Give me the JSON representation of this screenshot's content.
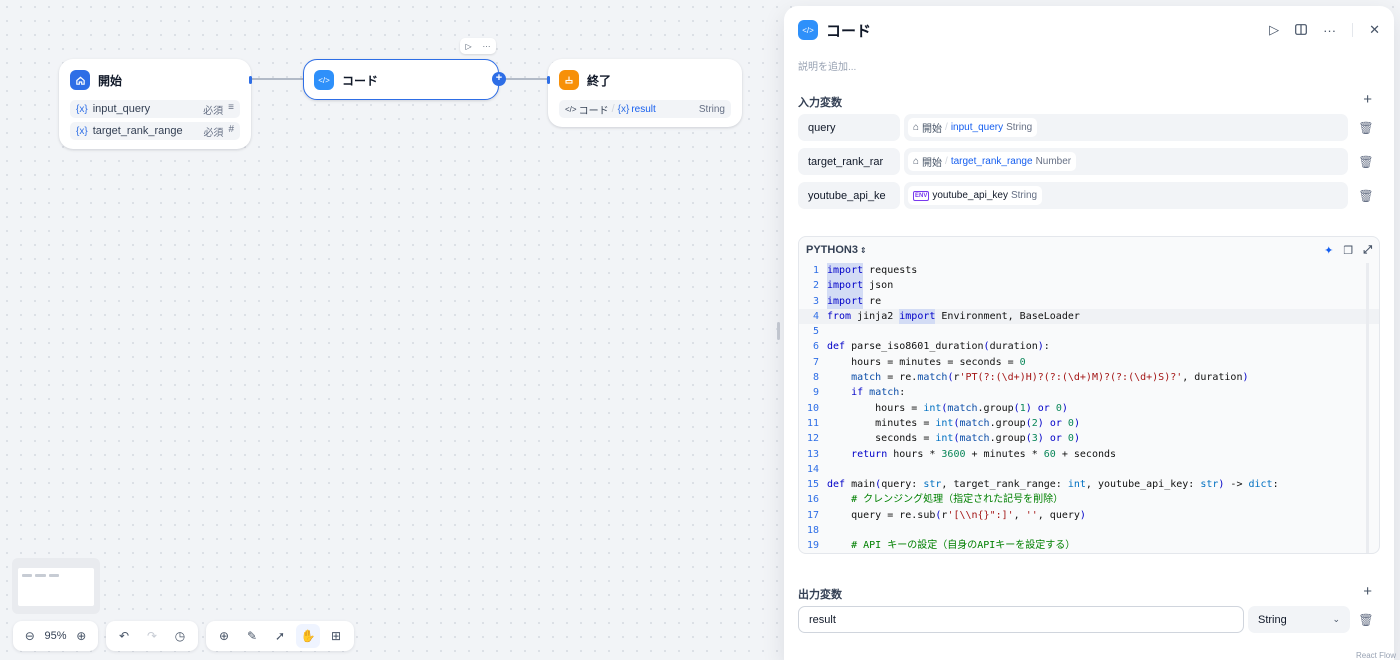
{
  "nodes": {
    "start": {
      "title": "開始",
      "vars": [
        {
          "name": "input_query",
          "required": "必須",
          "type_icon": "text-lines-icon"
        },
        {
          "name": "target_rank_range",
          "required": "必須",
          "type_icon": "hash-icon"
        }
      ]
    },
    "code": {
      "title": "コード"
    },
    "end": {
      "title": "終了",
      "source_node": "コード",
      "var_name": "result",
      "var_type": "String"
    }
  },
  "panel": {
    "title": "コード",
    "description_placeholder": "説明を追加...",
    "input_section_title": "入力変数",
    "inputs": [
      {
        "name": "query",
        "source_node": "開始",
        "var_name": "input_query",
        "var_type": "String"
      },
      {
        "name": "target_rank_rar",
        "source_node": "開始",
        "var_name": "target_rank_range",
        "var_type": "Number"
      },
      {
        "name": "youtube_api_ke",
        "source_node": "",
        "var_name": "youtube_api_key",
        "var_type": "String"
      }
    ],
    "language": "PYTHON3",
    "output_section_title": "出力変数",
    "output": {
      "name": "result",
      "type": "String"
    }
  },
  "code_lines": [
    {
      "n": "1",
      "active": false,
      "tokens": [
        [
          "kwsel",
          "import"
        ],
        [
          "ct",
          " requests"
        ]
      ]
    },
    {
      "n": "2",
      "active": false,
      "tokens": [
        [
          "kwsel",
          "import"
        ],
        [
          "ct",
          " json"
        ]
      ]
    },
    {
      "n": "3",
      "active": false,
      "tokens": [
        [
          "kwsel",
          "import"
        ],
        [
          "ct",
          " re"
        ]
      ]
    },
    {
      "n": "4",
      "active": true,
      "tokens": [
        [
          "kw",
          "from"
        ],
        [
          "ct",
          " jinja2 "
        ],
        [
          "kwsel",
          "import"
        ],
        [
          "ct",
          " Environment, BaseLoader"
        ]
      ]
    },
    {
      "n": "5",
      "active": false,
      "tokens": []
    },
    {
      "n": "6",
      "active": false,
      "tokens": [
        [
          "kw",
          "def"
        ],
        [
          "ct",
          " parse_iso8601_duration"
        ],
        [
          "kw",
          "("
        ],
        [
          "ct",
          "duration"
        ],
        [
          "kw",
          ")"
        ],
        [
          "ct",
          ":"
        ]
      ]
    },
    {
      "n": "7",
      "active": false,
      "tokens": [
        [
          "ct",
          "    hours = minutes = seconds = "
        ],
        [
          "num",
          "0"
        ]
      ]
    },
    {
      "n": "8",
      "active": false,
      "tokens": [
        [
          "ct",
          "    "
        ],
        [
          "vr",
          "match"
        ],
        [
          "ct",
          " = re."
        ],
        [
          "vr",
          "match"
        ],
        [
          "kw",
          "("
        ],
        [
          "ct",
          "r"
        ],
        [
          "str",
          "'PT(?:(\\d+)H)?(?:(\\d+)M)?(?:(\\d+)S)?'"
        ],
        [
          "ct",
          ", duration"
        ],
        [
          "kw",
          ")"
        ]
      ]
    },
    {
      "n": "9",
      "active": false,
      "tokens": [
        [
          "ct",
          "    "
        ],
        [
          "kw",
          "if"
        ],
        [
          "ct",
          " "
        ],
        [
          "vr",
          "match"
        ],
        [
          "ct",
          ":"
        ]
      ]
    },
    {
      "n": "10",
      "active": false,
      "tokens": [
        [
          "ct",
          "        hours = "
        ],
        [
          "bi",
          "int"
        ],
        [
          "kw",
          "("
        ],
        [
          "vr",
          "match"
        ],
        [
          "ct",
          ".group"
        ],
        [
          "kw",
          "("
        ],
        [
          "num",
          "1"
        ],
        [
          "kw",
          ")"
        ],
        [
          "ct",
          " "
        ],
        [
          "kw",
          "or"
        ],
        [
          "ct",
          " "
        ],
        [
          "num",
          "0"
        ],
        [
          "kw",
          ")"
        ]
      ]
    },
    {
      "n": "11",
      "active": false,
      "tokens": [
        [
          "ct",
          "        minutes = "
        ],
        [
          "bi",
          "int"
        ],
        [
          "kw",
          "("
        ],
        [
          "vr",
          "match"
        ],
        [
          "ct",
          ".group"
        ],
        [
          "kw",
          "("
        ],
        [
          "num",
          "2"
        ],
        [
          "kw",
          ")"
        ],
        [
          "ct",
          " "
        ],
        [
          "kw",
          "or"
        ],
        [
          "ct",
          " "
        ],
        [
          "num",
          "0"
        ],
        [
          "kw",
          ")"
        ]
      ]
    },
    {
      "n": "12",
      "active": false,
      "tokens": [
        [
          "ct",
          "        seconds = "
        ],
        [
          "bi",
          "int"
        ],
        [
          "kw",
          "("
        ],
        [
          "vr",
          "match"
        ],
        [
          "ct",
          ".group"
        ],
        [
          "kw",
          "("
        ],
        [
          "num",
          "3"
        ],
        [
          "kw",
          ")"
        ],
        [
          "ct",
          " "
        ],
        [
          "kw",
          "or"
        ],
        [
          "ct",
          " "
        ],
        [
          "num",
          "0"
        ],
        [
          "kw",
          ")"
        ]
      ]
    },
    {
      "n": "13",
      "active": false,
      "tokens": [
        [
          "ct",
          "    "
        ],
        [
          "kw",
          "return"
        ],
        [
          "ct",
          " hours * "
        ],
        [
          "num",
          "3600"
        ],
        [
          "ct",
          " + minutes * "
        ],
        [
          "num",
          "60"
        ],
        [
          "ct",
          " + seconds"
        ]
      ]
    },
    {
      "n": "14",
      "active": false,
      "tokens": []
    },
    {
      "n": "15",
      "active": false,
      "tokens": [
        [
          "kw",
          "def"
        ],
        [
          "ct",
          " main"
        ],
        [
          "kw",
          "("
        ],
        [
          "ct",
          "query: "
        ],
        [
          "bi",
          "str"
        ],
        [
          "ct",
          ", target_rank_range: "
        ],
        [
          "bi",
          "int"
        ],
        [
          "ct",
          ", youtube_api_key: "
        ],
        [
          "bi",
          "str"
        ],
        [
          "kw",
          ")"
        ],
        [
          "ct",
          " -> "
        ],
        [
          "bi",
          "dict"
        ],
        [
          "ct",
          ":"
        ]
      ]
    },
    {
      "n": "16",
      "active": false,
      "tokens": [
        [
          "ct",
          "    "
        ],
        [
          "cm",
          "# クレンジング処理（指定された記号を削除）"
        ]
      ]
    },
    {
      "n": "17",
      "active": false,
      "tokens": [
        [
          "ct",
          "    query = re.sub"
        ],
        [
          "kw",
          "("
        ],
        [
          "ct",
          "r"
        ],
        [
          "str",
          "'[\\\\n{}\":]'"
        ],
        [
          "ct",
          ", "
        ],
        [
          "str",
          "''"
        ],
        [
          "ct",
          ", query"
        ],
        [
          "kw",
          ")"
        ]
      ]
    },
    {
      "n": "18",
      "active": false,
      "tokens": []
    },
    {
      "n": "19",
      "active": false,
      "tokens": [
        [
          "ct",
          "    "
        ],
        [
          "cm",
          "# API キーの設定（自身のAPIキーを設定する）"
        ]
      ]
    }
  ],
  "toolbar": {
    "zoom": "95%"
  },
  "watermark": "React Flow",
  "colors": {
    "accent": "#2e6ee6",
    "start_icon": "#2e6ee6",
    "code_icon": "#2e90fa",
    "end_icon": "#f79009"
  }
}
